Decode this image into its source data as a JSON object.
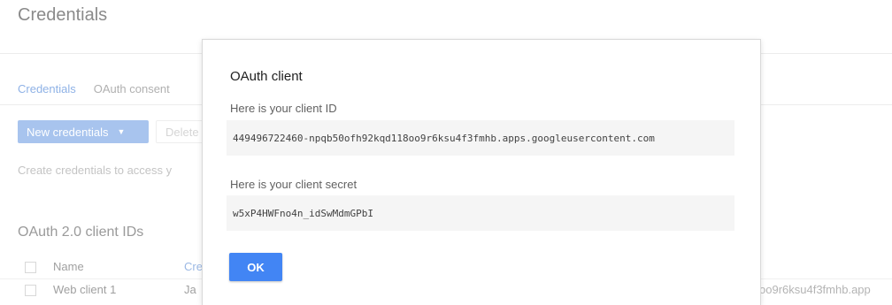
{
  "page": {
    "title": "Credentials",
    "tabs": [
      {
        "label": "Credentials"
      },
      {
        "label": "OAuth consent"
      }
    ],
    "toolbar": {
      "new_credentials_label": "New credentials",
      "delete_label": "Delete"
    },
    "help_text": "Create credentials to access y",
    "section_title": "OAuth 2.0 client IDs",
    "table": {
      "columns": [
        "Name",
        "Cre"
      ],
      "rows": [
        {
          "name": "Web client 1",
          "creation": "Ja",
          "client_id_tail": "oo9r6ksu4f3fmhb.app"
        }
      ]
    }
  },
  "dialog": {
    "title": "OAuth client",
    "client_id_label": "Here is your client ID",
    "client_id": "449496722460-npqb50ofh92kqd118oo9r6ksu4f3fmhb.apps.googleusercontent.com",
    "client_secret_label": "Here is your client secret",
    "client_secret": "w5xP4HWFno4n_idSwMdmGPbI",
    "ok_label": "OK"
  },
  "colors": {
    "primary_button": "#4285f4",
    "disabled_button": "#a8c4ee",
    "active_tab": "#8fb2e6"
  },
  "icons": {
    "dropdown": "caret-down-icon"
  }
}
